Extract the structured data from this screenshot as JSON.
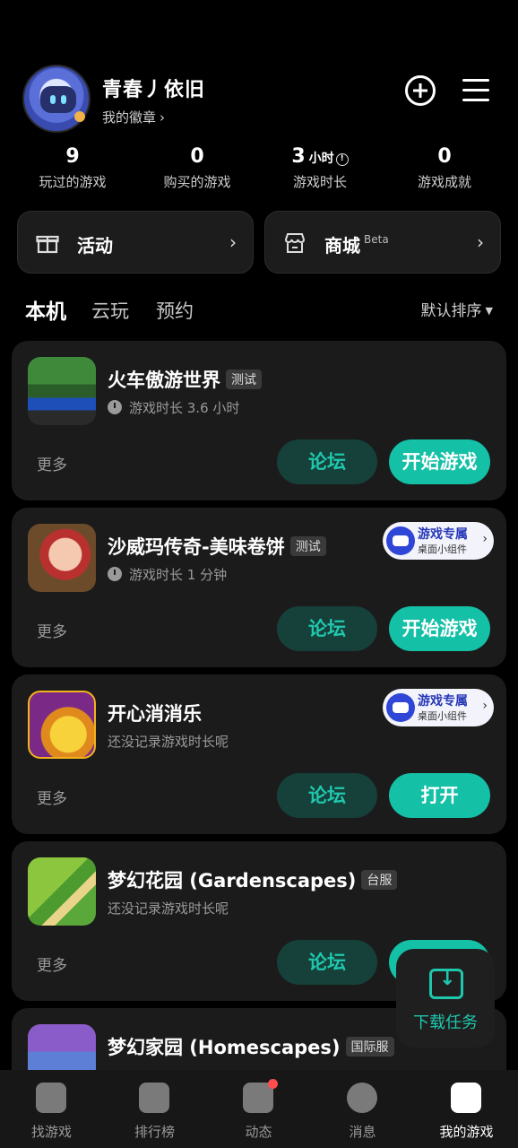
{
  "profile": {
    "username": "青春丿依旧",
    "badge_link": "我的徽章"
  },
  "stats": [
    {
      "value": "9",
      "unit": "",
      "label": "玩过的游戏"
    },
    {
      "value": "0",
      "unit": "",
      "label": "购买的游戏"
    },
    {
      "value": "3",
      "unit": "小时",
      "label": "游戏时长"
    },
    {
      "value": "0",
      "unit": "",
      "label": "游戏成就"
    }
  ],
  "quick_links": {
    "activity": "活动",
    "store": "商城",
    "store_badge": "Beta"
  },
  "tabs": [
    "本机",
    "云玩",
    "预约"
  ],
  "sort_label": "默认排序",
  "widget": {
    "line1": "游戏专属",
    "line2": "桌面小组件"
  },
  "common": {
    "more": "更多",
    "forum": "论坛"
  },
  "games": [
    {
      "title": "火车傲游世界",
      "tag": "测试",
      "playtime": "游戏时长 3.6 小时",
      "action": "开始游戏",
      "widget": false
    },
    {
      "title": "沙威玛传奇-美味卷饼",
      "tag": "测试",
      "playtime": "游戏时长 1 分钟",
      "action": "开始游戏",
      "widget": true
    },
    {
      "title": "开心消消乐",
      "tag": "",
      "playtime": "还没记录游戏时长呢",
      "action": "打开",
      "widget": true
    },
    {
      "title": "梦幻花园 (Gardenscapes)",
      "tag": "台服",
      "playtime": "还没记录游戏时长呢",
      "action": "",
      "widget": false
    },
    {
      "title": "梦幻家园 (Homescapes)",
      "tag": "国际服",
      "playtime": "",
      "action": "",
      "widget": false
    }
  ],
  "download_fab": "下载任务",
  "bottom_nav": [
    "找游戏",
    "排行榜",
    "动态",
    "消息",
    "我的游戏"
  ],
  "colors": {
    "accent": "#14c0a6",
    "card": "#1b1b1b",
    "background": "#000000"
  }
}
